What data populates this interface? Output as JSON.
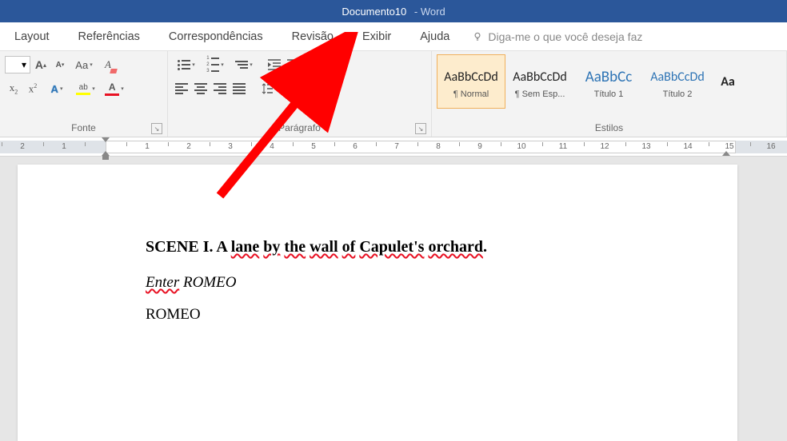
{
  "title": {
    "doc": "Documento10",
    "app": "Word"
  },
  "tabs": {
    "items": [
      "Layout",
      "Referências",
      "Correspondências",
      "Revisão",
      "Exibir",
      "Ajuda"
    ],
    "tell_me": "Diga-me o que você deseja faz"
  },
  "ribbon": {
    "font": {
      "label": "Fonte",
      "grow": "A",
      "shrink": "A",
      "case": "Aa"
    },
    "paragraph": {
      "label": "Parágrafo"
    },
    "styles": {
      "label": "Estilos",
      "items": [
        {
          "preview": "AaBbCcDd",
          "name": "¶ Normal",
          "color": "black",
          "selected": true
        },
        {
          "preview": "AaBbCcDd",
          "name": "¶ Sem Esp...",
          "color": "black",
          "selected": false
        },
        {
          "preview": "AaBbCc",
          "name": "Título 1",
          "color": "blue",
          "selected": false
        },
        {
          "preview": "AaBbCcDd",
          "name": "Título 2",
          "color": "blue",
          "selected": false
        },
        {
          "preview": "Aa",
          "name": "",
          "color": "black",
          "selected": false
        }
      ]
    }
  },
  "ruler": {
    "min": 0,
    "max": 15,
    "margin_left_cm": 1.25,
    "margin_right_cm": 14.5
  },
  "document": {
    "scene_prefix": "SCENE I. A ",
    "scene_words": [
      "lane",
      "by",
      "the",
      "wall",
      "of",
      "Capulet's",
      "orchard"
    ],
    "scene_suffix": ".",
    "direction_word1": "Enter",
    "direction_word2": "ROMEO",
    "speaker": "ROMEO"
  },
  "annotation": {
    "points_to_tab": "Revisão"
  }
}
